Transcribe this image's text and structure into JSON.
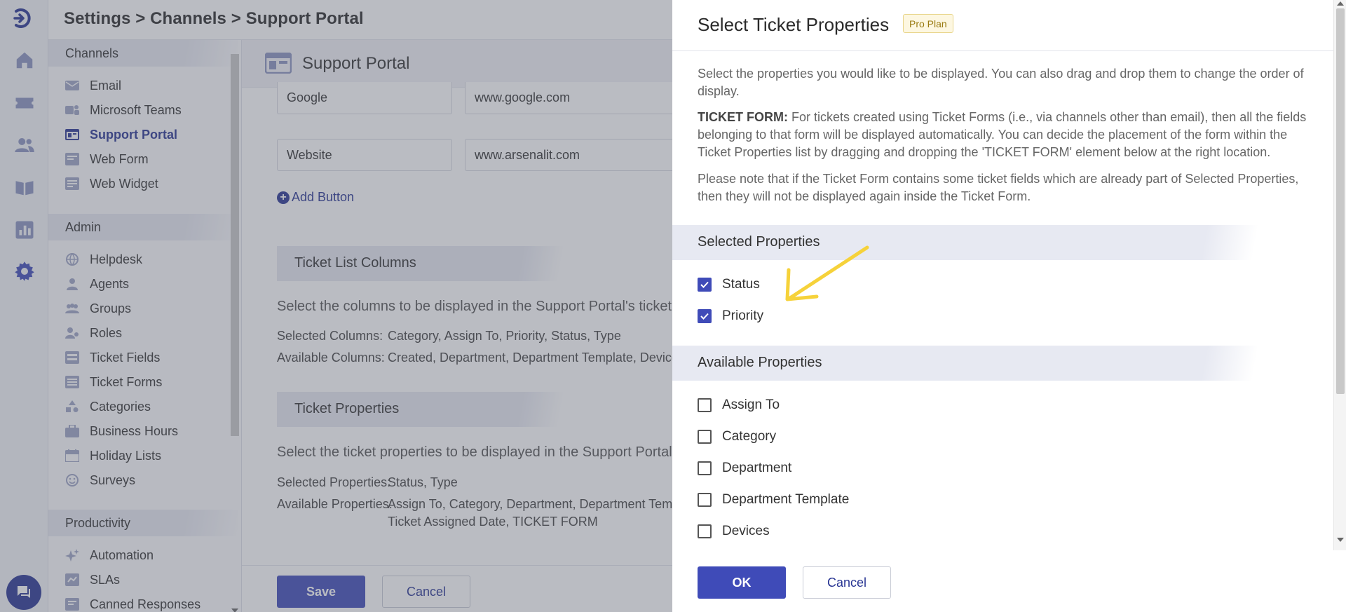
{
  "header": {
    "breadcrumb": "Settings > Channels > Support Portal"
  },
  "nav": {
    "channels_title": "Channels",
    "channels": [
      "Email",
      "Microsoft Teams",
      "Support Portal",
      "Web Form",
      "Web Widget"
    ],
    "admin_title": "Admin",
    "admin": [
      "Helpdesk",
      "Agents",
      "Groups",
      "Roles",
      "Ticket Fields",
      "Ticket Forms",
      "Categories",
      "Business Hours",
      "Holiday Lists",
      "Surveys"
    ],
    "productivity_title": "Productivity",
    "productivity": [
      "Automation",
      "SLAs",
      "Canned Responses"
    ]
  },
  "main": {
    "page_title": "Support Portal",
    "link1_name": "Google",
    "link1_url": "www.google.com",
    "link2_name": "Website",
    "link2_url": "www.arsenalit.com",
    "add_button": "Add Button",
    "list_columns_title": "Ticket List Columns",
    "list_columns_desc": "Select the columns to be displayed in the Support Portal's ticket",
    "selected_columns_label": "Selected Columns:",
    "selected_columns_value": "Category, Assign To, Priority, Status, Type",
    "available_columns_label": "Available Columns:",
    "available_columns_value": "Created, Department, Department Template, Devices",
    "ticket_props_title": "Ticket Properties",
    "ticket_props_desc": "Select the ticket properties to be displayed in the Support Portal",
    "selected_props_label": "Selected Properties:",
    "selected_props_value": "Status, Type",
    "available_props_label": "Available Properties:",
    "available_props_value1": "Assign To, Category, Department, Department Temp",
    "available_props_value2": "Ticket Assigned Date, TICKET FORM",
    "save": "Save",
    "cancel": "Cancel"
  },
  "panel": {
    "title": "Select Ticket Properties",
    "badge": "Pro Plan",
    "intro": "Select the properties you would like to be displayed. You can also drag and drop them to change the order of display.",
    "form_label": "TICKET FORM:",
    "form_text": " For tickets created using Ticket Forms (i.e., via channels other than email), then all the fields belonging to that form will be displayed automatically. You can decide the placement of the form within the Ticket Properties list by dragging and dropping the 'TICKET FORM' element below at the right location.",
    "note": "Please note that if the Ticket Form contains some ticket fields which are already part of Selected Properties, then they will not be displayed again inside the Ticket Form.",
    "selected_title": "Selected Properties",
    "selected": [
      {
        "label": "Status",
        "checked": true
      },
      {
        "label": "Priority",
        "checked": true
      }
    ],
    "available_title": "Available Properties",
    "available": [
      {
        "label": "Assign To",
        "checked": false
      },
      {
        "label": "Category",
        "checked": false
      },
      {
        "label": "Department",
        "checked": false
      },
      {
        "label": "Department Template",
        "checked": false
      },
      {
        "label": "Devices",
        "checked": false
      }
    ],
    "ok": "OK",
    "cancel": "Cancel"
  },
  "colors": {
    "primary": "#3f4bb8",
    "accent": "#283593",
    "annotation_arrow": "#f6d23a"
  }
}
